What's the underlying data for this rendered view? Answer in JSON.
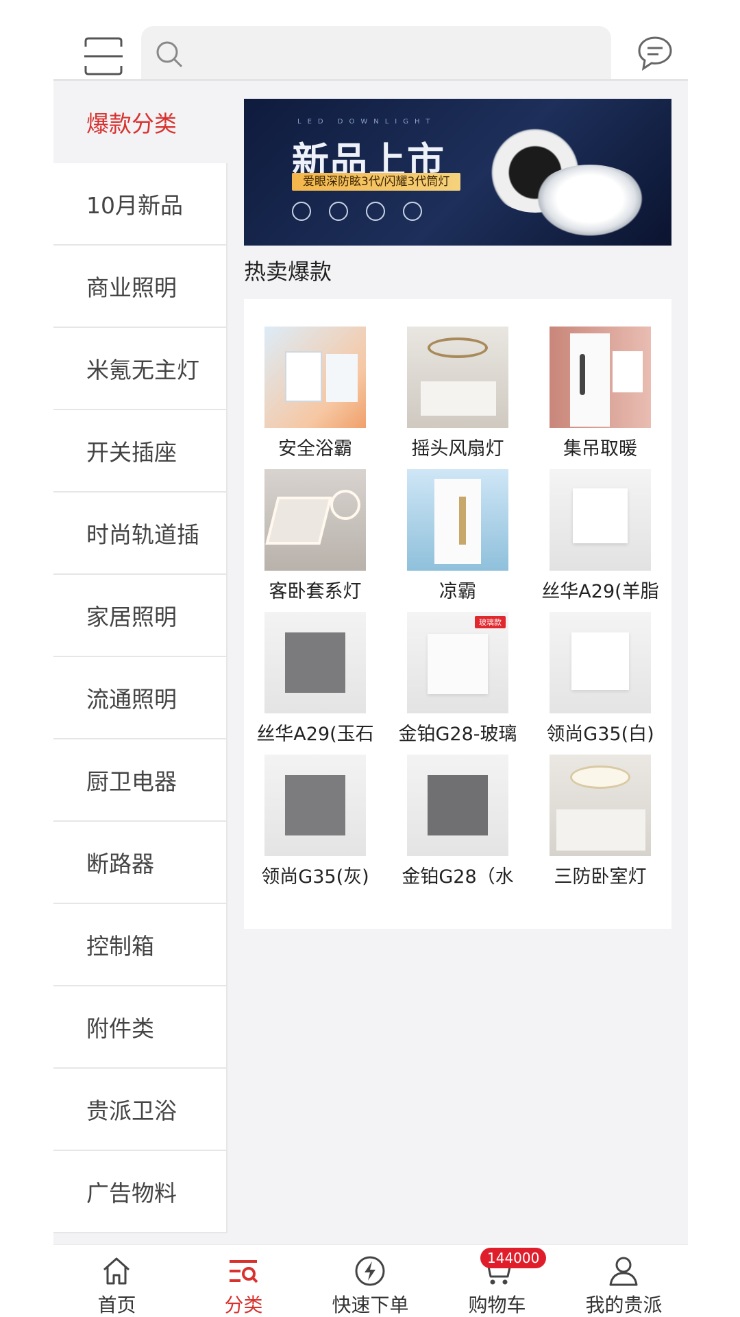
{
  "header": {
    "search_placeholder": "",
    "icons": {
      "scan": "scan-icon",
      "search": "search-icon",
      "message": "message-icon"
    }
  },
  "sidebar": {
    "items": [
      {
        "label": "爆款分类",
        "active": true
      },
      {
        "label": "10月新品"
      },
      {
        "label": "商业照明"
      },
      {
        "label": "米氪无主灯"
      },
      {
        "label": "开关插座"
      },
      {
        "label": "时尚轨道插"
      },
      {
        "label": "家居照明"
      },
      {
        "label": "流通照明"
      },
      {
        "label": "厨卫电器"
      },
      {
        "label": "断路器"
      },
      {
        "label": "控制箱"
      },
      {
        "label": "附件类"
      },
      {
        "label": "贵派卫浴"
      },
      {
        "label": "广告物料"
      }
    ]
  },
  "banner": {
    "small_text": "LED DOWNLIGHT",
    "title": "新品上市",
    "subtitle": "爱眼深防眩3代/闪耀3代筒灯"
  },
  "section": {
    "title": "热卖爆款"
  },
  "products": [
    {
      "label": "安全浴霸"
    },
    {
      "label": "摇头风扇灯"
    },
    {
      "label": "集吊取暖"
    },
    {
      "label": "客卧套系灯"
    },
    {
      "label": "凉霸"
    },
    {
      "label": "丝华A29(羊脂"
    },
    {
      "label": "丝华A29(玉石"
    },
    {
      "label": "金铂G28-玻璃"
    },
    {
      "label": "领尚G35(白)"
    },
    {
      "label": "领尚G35(灰)"
    },
    {
      "label": "金铂G28（水"
    },
    {
      "label": "三防卧室灯"
    }
  ],
  "badges": {
    "glass": "玻璃款"
  },
  "bottom_nav": {
    "items": [
      {
        "label": "首页",
        "icon": "home-icon"
      },
      {
        "label": "分类",
        "icon": "category-icon",
        "active": true
      },
      {
        "label": "快速下单",
        "icon": "quick-order-icon"
      },
      {
        "label": "购物车",
        "icon": "cart-icon"
      },
      {
        "label": "我的贵派",
        "icon": "profile-icon"
      }
    ],
    "cart_badge": "144000"
  },
  "colors": {
    "accent": "#d8322f",
    "badge": "#e01e2b",
    "bg": "#f3f3f5"
  }
}
